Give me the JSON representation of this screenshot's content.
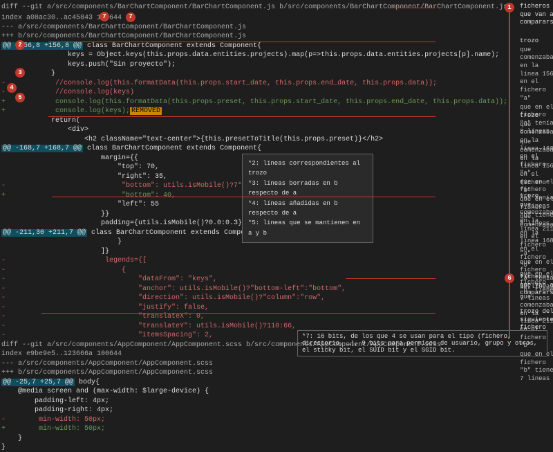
{
  "diff": {
    "file1": {
      "cmd": "diff --git a/src/components/BarChartComponent/BarChartComponent.js b/src/components/BarChartComponent/BarChartComponent.js",
      "index": "index a08ac30..ac45843 100644",
      "minus": "--- a/src/components/BarChartComponent/BarChartComponent.js",
      "plus": "+++ b/src/components/BarChartComponent/BarChartComponent.js",
      "hunk1": {
        "range": "@@ -156,8 +156,8 @@",
        "ctx": " class BarChartComponent extends Component{",
        "l1": "                keys = Object.keys(this.props.data.entities.projects).map(p=>this.props.data.entities.projects[p].name);",
        "l2": "                keys.push(\"Sin proyecto\");",
        "l3": "            }",
        "rem1": "-            //console.log(this.formatData(this.props.start_date, this.props.end_date, this.props.data));",
        "rem2": "-            //console.log(keys)",
        "add1": "+            console.log(this.formatData(this.props.preset, this.props.start_date, this.props.end_date, this.props.data));",
        "add2a": "+            console.log(keys);",
        "add2b": "REMOVED",
        "l4": "            return(",
        "l5": "                <div>",
        "l6": "                    <h2 className=\"text-center\">{this.presetToTitle(this.props.preset)}</h2>"
      },
      "hunk2": {
        "range": "@@ -168,7 +168,7 @@",
        "ctx": " class BarChartComponent extends Component{",
        "l1": "                        margin={{",
        "l2": "                            \"top\": 70,",
        "l3": "                            \"right\": 35,",
        "rem": "-                            \"bottom\": utils.isMobile()?7*keys.length:60,",
        "add": "+                            \"bottom\": 40,",
        "l4": "                            \"left\": 55",
        "l5": "                        }}",
        "l6": "                        padding={utils.isMobile()?0.0:0.3}"
      },
      "hunk3": {
        "range": "@@ -211,30 +211,7 @@",
        "ctx": " class BarChartComponent extends Component{",
        "l1": "                            }",
        "l2": "                        ]}",
        "rem1": "-                        legends={[",
        "rem2": "-                            {",
        "rem3": "-                                \"dataFrom\": \"keys\",",
        "rem4": "-                                \"anchor\": utils.isMobile()?\"bottom-left\":\"bottom\",",
        "rem5": "-                                \"direction\": utils.isMobile()?\"column\":\"row\",",
        "rem6": "-                                \"justify\": false,",
        "rem7": "-                                \"translateX\": 0,",
        "rem8": "-                                \"translateY\": utils.isMobile()?110:66,",
        "rem9": "-                                \"itemsSpacing\": 2,"
      }
    },
    "file2": {
      "cmd": "diff --git a/src/components/AppComponent/AppComponent.scss b/src/components/AppComponent/AppComponent.scss",
      "index": "index e9be9e5..123666a 100644",
      "minus": "--- a/src/components/AppComponent/AppComponent.scss",
      "plus": "+++ b/src/components/AppComponent/AppComponent.scss",
      "hunk": {
        "range": "@@ -25,7 +25,7 @@",
        "ctx": " body{",
        "l1": "    @media screen and (max-width: $large-device) {",
        "l2": "        padding-left: 4px;",
        "l3": "        padding-right: 4px;",
        "rem": "-        min-width: 50px;",
        "add": "+        min-width: 50px;",
        "l4": "    }",
        "l5": "}"
      }
    }
  },
  "badges": {
    "b1": "1",
    "b2": "2",
    "b3": "3",
    "b4": "4",
    "b5": "5",
    "b6": "6",
    "b7": "7"
  },
  "mode_bits": "7",
  "notes": {
    "n1": "ficheros que van a compararse",
    "h2a": "trozo",
    "h2b": "que comenzaba en la línea 156 en el fichero \"a\"",
    "h2c": "que en el fichero \"a\" tenía 8 líneas",
    "h2d": "que comenzaba en la línea 156 en el fichero \"b\"",
    "h2e": "que en el fichero \"b\" tiene 8 líneas",
    "h3a": "trozo",
    "h3b": "que comenzaba en la línea 168 en el fichero \"a\"",
    "h3c": "que en el fichero \"a\" tenía 7 líneas",
    "h3d": "que comenzaba en la línea 168 en el fichero \"b\"",
    "h3e": "que en el fichero \"b\" tiene 7 líneas",
    "h4a": "trozo",
    "h4b": "que comenzaba en la línea 211 en el fichero \"a\"",
    "h4c": "que en el fichero \"a\" tenía 30 líneas",
    "h4d": "que comenzaba en la línea 211 en el fichero \"b\"",
    "h4e": "que en el fichero \"b\" tiene 7 líneas",
    "n6": "ficheros que van a compararse",
    "n7": "trozo del siguiente fichero"
  },
  "legend": {
    "l2": "*2: líneas correspondientes al trozo",
    "l3": "*3: líneas borradas en b respecto de a",
    "l4": "*4: líneas añadidas en b respecto de a",
    "l5": "*5: líneas que se mantienen en a y b"
  },
  "footer": "*7: 16 bits, de los que 4 se usan para el tipo (fichero, directorio, …), 9 bits para permisos de usuario, grupo y otros, el sticky bit, el SUID bit y el SGID bit."
}
